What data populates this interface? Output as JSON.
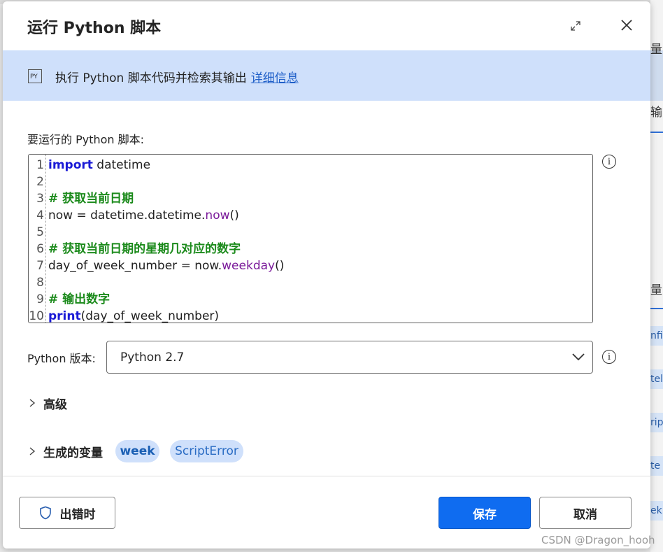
{
  "dialog": {
    "title": "运行 Python 脚本",
    "expand_icon": "expand-icon",
    "close_icon": "close-icon"
  },
  "banner": {
    "icon": "python-file-icon",
    "icon_text": "PY",
    "text": "执行 Python 脚本代码并检索其输出",
    "link": "详细信息"
  },
  "script": {
    "label": "要运行的 Python 脚本:",
    "lines": [
      {
        "n": "1",
        "parts": [
          {
            "t": "import",
            "c": "kw"
          },
          {
            "t": " datetime",
            "c": ""
          }
        ]
      },
      {
        "n": "2",
        "parts": []
      },
      {
        "n": "3",
        "parts": [
          {
            "t": "# 获取当前日期",
            "c": "cm"
          }
        ]
      },
      {
        "n": "4",
        "parts": [
          {
            "t": "now = datetime.datetime.",
            "c": ""
          },
          {
            "t": "now",
            "c": "fn"
          },
          {
            "t": "()",
            "c": ""
          }
        ]
      },
      {
        "n": "5",
        "parts": []
      },
      {
        "n": "6",
        "parts": [
          {
            "t": "# 获取当前日期的星期几对应的数字",
            "c": "cm"
          }
        ]
      },
      {
        "n": "7",
        "parts": [
          {
            "t": "day_of_week_number = now.",
            "c": ""
          },
          {
            "t": "weekday",
            "c": "fn"
          },
          {
            "t": "()",
            "c": ""
          }
        ]
      },
      {
        "n": "8",
        "parts": []
      },
      {
        "n": "9",
        "parts": [
          {
            "t": "# 输出数字",
            "c": "cm"
          }
        ]
      },
      {
        "n": "10",
        "parts": [
          {
            "t": "print",
            "c": "kw"
          },
          {
            "t": "(day_of_week_number)",
            "c": ""
          }
        ]
      }
    ]
  },
  "version": {
    "label": "Python 版本:",
    "value": "Python 2.7"
  },
  "advanced": {
    "label": "高级"
  },
  "variables": {
    "label": "生成的变量",
    "chips": [
      "week",
      "ScriptError"
    ]
  },
  "footer": {
    "on_error": "出错时",
    "save": "保存",
    "cancel": "取消"
  },
  "colors": {
    "primary": "#0f6cf0",
    "banner_bg": "#cfe0fb",
    "keyword": "#1a1ad6",
    "comment": "#1b8a1b",
    "function": "#7a1a9a",
    "link": "#1f5fc8"
  },
  "background_app": {
    "fragments": [
      "量",
      "输",
      "量"
    ],
    "chips": [
      "nfi",
      "tel",
      "rip",
      "te",
      "ek"
    ]
  },
  "watermark": "CSDN @Dragon_hooh"
}
